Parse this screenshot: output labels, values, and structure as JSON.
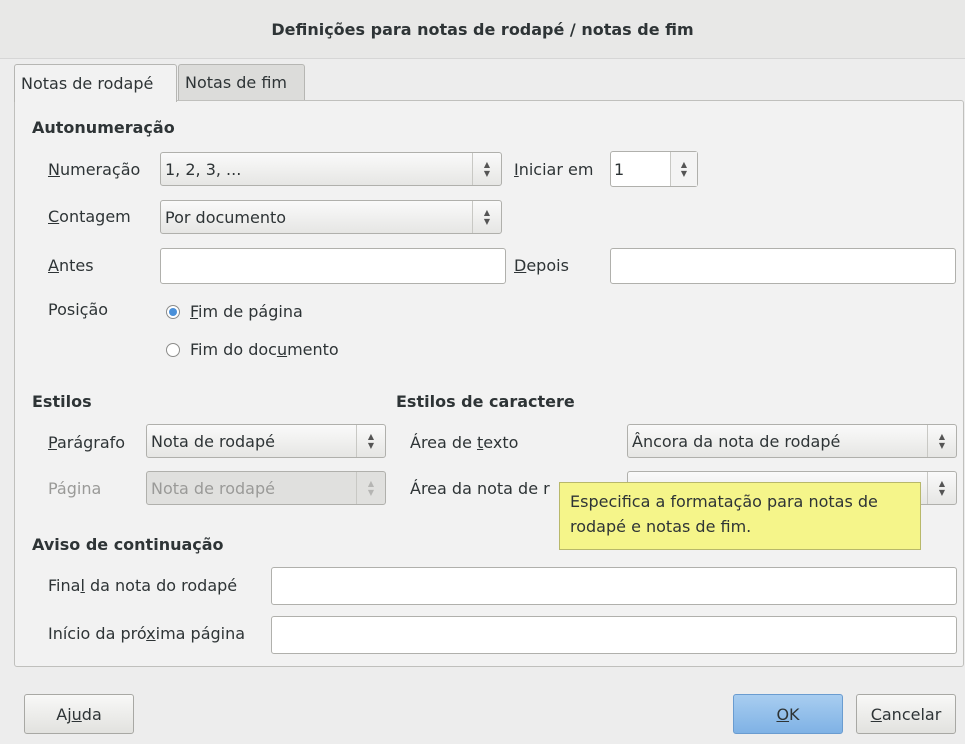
{
  "window": {
    "title": "Definições para notas de rodapé / notas de fim"
  },
  "tabs": [
    {
      "label": "Notas de rodapé",
      "active": true
    },
    {
      "label": "Notas de fim",
      "active": false
    }
  ],
  "autonumeracao": {
    "heading": "Autonumeração",
    "numeracao": {
      "label_mn": "N",
      "label_rest": "umeração",
      "value": "1, 2, 3, ..."
    },
    "iniciar_em": {
      "label_mn": "I",
      "label_rest": "niciar em",
      "value": "1"
    },
    "contagem": {
      "label_mn": "C",
      "label_rest": "ontagem",
      "value": "Por documento"
    },
    "antes": {
      "label_mn": "A",
      "label_rest": "ntes",
      "value": ""
    },
    "depois": {
      "label_mn": "D",
      "label_rest": "epois",
      "value": ""
    },
    "posicao": {
      "label": "Posição",
      "options": [
        {
          "mn": "F",
          "rest": "im de página",
          "selected": true
        },
        {
          "pre": "Fim do doc",
          "mn": "u",
          "rest": "mento",
          "selected": false
        }
      ]
    }
  },
  "estilos": {
    "heading": "Estilos",
    "paragrafo": {
      "label_mn": "P",
      "label_rest": "arágrafo",
      "value": "Nota de rodapé"
    },
    "pagina": {
      "label": "Página",
      "value": "Nota de rodapé"
    }
  },
  "estilos_caractere": {
    "heading": "Estilos de caractere",
    "area_texto": {
      "label_pre": "Área de ",
      "label_mn": "t",
      "label_rest": "exto",
      "value": "Âncora da nota de rodapé"
    },
    "area_nota": {
      "label": "Área da nota de r",
      "value": ""
    }
  },
  "aviso": {
    "heading": "Aviso de continuação",
    "final": {
      "label_pre": "Fina",
      "label_mn": "l",
      "label_rest": " da nota do rodapé",
      "value": ""
    },
    "inicio": {
      "label_pre": "Início da pró",
      "label_mn": "x",
      "label_rest": "ima página",
      "value": ""
    }
  },
  "tooltip": {
    "text": "Especifica a formatação para notas de rodapé e notas de fim."
  },
  "buttons": {
    "help": {
      "pre": "Aj",
      "mn": "u",
      "rest": "da"
    },
    "ok": {
      "mn": "O",
      "rest": "K"
    },
    "cancel": {
      "mn": "C",
      "rest": "ancelar"
    }
  },
  "colors": {
    "ok_button": "#7fb2e5",
    "tooltip": "#f5f58a",
    "radio_selected": "#4a90d9"
  }
}
